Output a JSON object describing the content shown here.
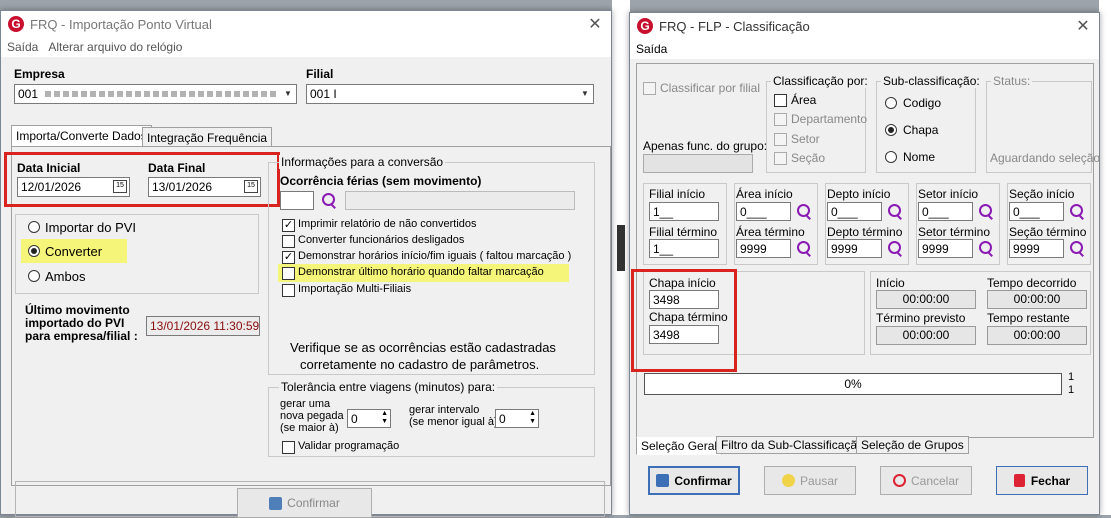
{
  "win1": {
    "title": "FRQ - Importação Ponto Virtual",
    "menu": [
      "Saída",
      "Alterar arquivo do relógio"
    ],
    "empresa_label": "Empresa",
    "empresa_value": "001",
    "filial_label": "Filial",
    "filial_value": "001 I",
    "tabs": [
      "Importa/Converte Dados",
      "Integração Frequência"
    ],
    "data_inicial_label": "Data Inicial",
    "data_inicial": "12/01/2026",
    "data_final_label": "Data Final",
    "data_final": "13/01/2026",
    "cal_icon": "15",
    "radios": [
      "Importar do PVI",
      "Converter",
      "Ambos"
    ],
    "ultimo_label": [
      "Último movimento",
      "importado do PVI",
      "para empresa/filial :"
    ],
    "ultimo_value": "13/01/2026  11:30:59",
    "info_group": "Informações para a conversão",
    "ocorrencia_label": "Ocorrência férias (sem movimento)",
    "checks": [
      "Imprimir relatório de não convertidos",
      "Converter funcionários desligados",
      "Demonstrar horários início/fim iguais ( faltou marcação )",
      "Demonstrar último horário quando faltar marcação",
      "Importação Multi-Filiais"
    ],
    "note": [
      "Verifique se as ocorrências estão cadastradas",
      "corretamente  no cadastro de parâmetros."
    ],
    "tol_group": "Tolerância entre viagens (minutos) para:",
    "gerar_pegada": [
      "gerar uma",
      "nova pegada",
      "(se maior à)"
    ],
    "gerar_pegada_value": "0",
    "gerar_intervalo": [
      "gerar intervalo",
      "(se menor igual à)"
    ],
    "gerar_intervalo_value": "0",
    "validar": "Validar programação",
    "confirmar": "Confirmar"
  },
  "win2": {
    "title": "FRQ - FLP - Classificação",
    "menu": "Saída",
    "classificar_filial": "Classificar por filial",
    "apenas_label": "Apenas func. do grupo:",
    "classif_group": "Classificação  por:",
    "classif_opts": [
      "Área",
      "Departamento",
      "Setor",
      "Seção"
    ],
    "subclass_group": "Sub-classificação:",
    "subclass_opts": [
      "Codigo",
      "Chapa",
      "Nome"
    ],
    "status_group": "Status:",
    "status_text": "Aguardando seleção",
    "filial_inicio": "Filial início",
    "filial_inicio_v": "1__",
    "filial_termino": "Filial término",
    "filial_termino_v": "1__",
    "area_inicio": "Área início",
    "area_inicio_v": "0___",
    "area_termino": "Área término",
    "area_termino_v": "9999",
    "depto_inicio": "Depto início",
    "depto_inicio_v": "0___",
    "depto_termino": "Depto término",
    "depto_termino_v": "9999",
    "setor_inicio": "Setor início",
    "setor_inicio_v": "0___",
    "setor_termino": "Setor término",
    "setor_termino_v": "9999",
    "secao_inicio": "Seção início",
    "secao_inicio_v": "0___",
    "secao_termino": "Seção término",
    "secao_termino_v": "9999",
    "chapa_inicio": "Chapa início",
    "chapa_inicio_v": "3498",
    "chapa_termino": "Chapa término",
    "chapa_termino_v": "3498",
    "inicio": "Início",
    "inicio_v": "00:00:00",
    "decorrido": "Tempo decorrido",
    "decorrido_v": "00:00:00",
    "termino_prev": "Término previsto",
    "termino_prev_v": "00:00:00",
    "restante": "Tempo restante",
    "restante_v": "00:00:00",
    "progress_text": "0%",
    "progress_count_a": "1",
    "progress_count_b": "1",
    "tabs": [
      "Seleção Geral",
      "Filtro da Sub-Classificação",
      "Seleção de Grupos"
    ],
    "btn_confirmar": "Confirmar",
    "btn_pausar": "Pausar",
    "btn_cancelar": "Cancelar",
    "btn_fechar": "Fechar"
  },
  "colors": {
    "highlight": "#f5f57a",
    "red_box": "#d9231e",
    "brand": "#c8102e",
    "magnifier": "#8a1ab3"
  }
}
